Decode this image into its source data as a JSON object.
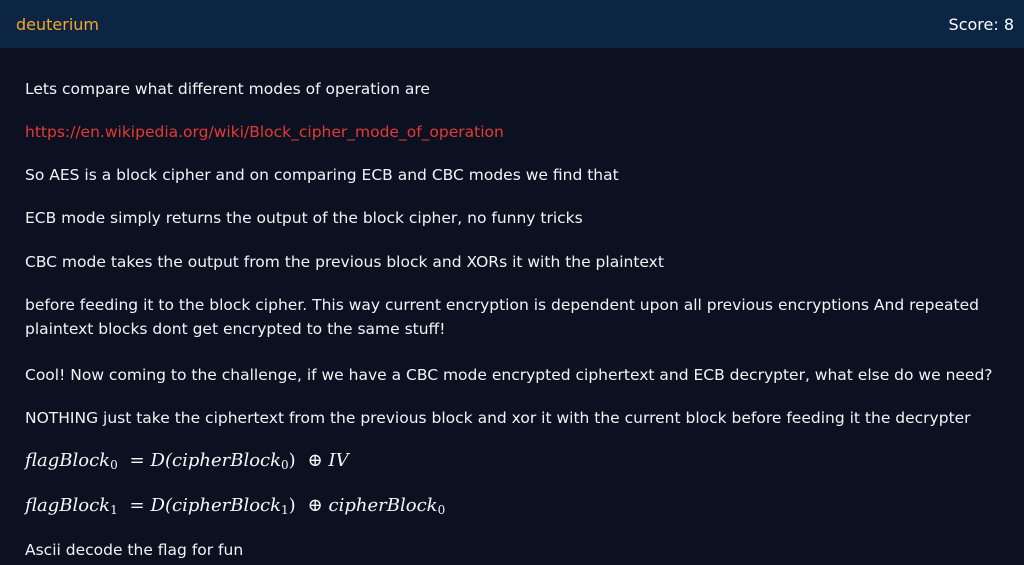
{
  "header": {
    "brand": "deuterium",
    "score": "Score: 8"
  },
  "article": {
    "p1": "Lets compare what different modes of operation are",
    "link": "https://en.wikipedia.org/wiki/Block_cipher_mode_of_operation",
    "p2": "So AES is a block cipher and on comparing ECB and CBC modes we find that",
    "p3": "ECB mode simply returns the output of the block cipher, no funny tricks",
    "p4": "CBC mode takes the output from the previous block and XORs it with the plaintext",
    "p5": "before feeding it to the block cipher. This way current encryption is dependent upon all previous encryptions And repeated plaintext blocks dont get encrypted to the same stuff!",
    "p6": "Cool! Now coming to the challenge, if we have a CBC mode encrypted ciphertext and ECB decrypter, what else do we need?",
    "p7": "NOTHING just take the ciphertext from the previous block and xor it with the current block before feeding it the decrypter",
    "formula1": {
      "lhs": "flagBlock",
      "lhs_sub": "0",
      "eq": "=",
      "fn": "D(cipherBlock",
      "fn_sub": "0",
      "close": ")",
      "xor": "⊕",
      "rhs": "IV",
      "rhs_sub": ""
    },
    "formula2": {
      "lhs": "flagBlock",
      "lhs_sub": "1",
      "eq": "=",
      "fn": "D(cipherBlock",
      "fn_sub": "1",
      "close": ")",
      "xor": "⊕",
      "rhs": "cipherBlock",
      "rhs_sub": "0"
    },
    "p8": "Ascii decode the flag for fun"
  }
}
